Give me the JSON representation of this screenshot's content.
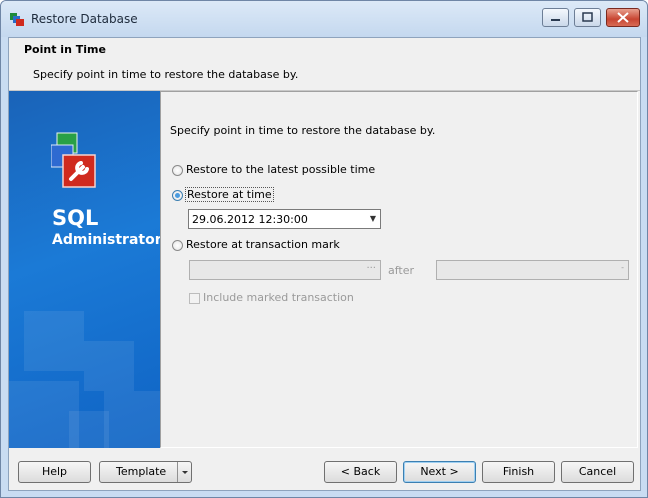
{
  "window": {
    "title": "Restore Database"
  },
  "header": {
    "title": "Point in Time",
    "subtitle": "Specify point in time to restore the database by."
  },
  "sidebar": {
    "brand_line1": "SQL",
    "brand_line2": "Administrator"
  },
  "main": {
    "intro": "Specify point in time to restore the database by.",
    "options": {
      "latest": {
        "label": "Restore to the latest possible time",
        "selected": false
      },
      "at_time": {
        "label": "Restore at time",
        "selected": true,
        "value": "29.06.2012 12:30:00"
      },
      "mark": {
        "label": "Restore at transaction mark",
        "selected": false,
        "after_label": "after",
        "ellipsis": "···"
      },
      "include_marked": {
        "label": "Include marked transaction",
        "checked": false
      }
    }
  },
  "footer": {
    "help": "Help",
    "template": "Template",
    "back": "< Back",
    "next": "Next >",
    "finish": "Finish",
    "cancel": "Cancel"
  },
  "colors": {
    "sidebar": "#1b7ad6",
    "title_bar": "#c9dcf2",
    "dialog": "#f0f0f0"
  }
}
